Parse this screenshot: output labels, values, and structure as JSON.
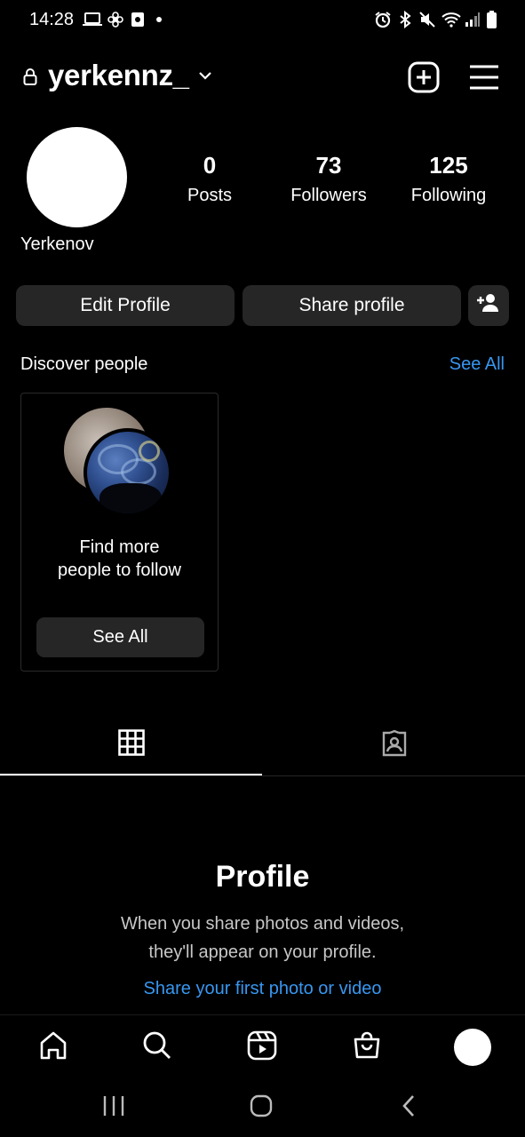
{
  "status_bar": {
    "time": "14:28"
  },
  "header": {
    "username": "yerkennz_"
  },
  "profile": {
    "display_name": "Yerkenov",
    "stats": {
      "posts": {
        "value": "0",
        "label": "Posts"
      },
      "followers": {
        "value": "73",
        "label": "Followers"
      },
      "following": {
        "value": "125",
        "label": "Following"
      }
    }
  },
  "actions": {
    "edit_label": "Edit Profile",
    "share_label": "Share profile"
  },
  "discover": {
    "title": "Discover people",
    "see_all": "See All",
    "card": {
      "line1": "Find more",
      "line2": "people to follow",
      "button": "See All"
    }
  },
  "empty_state": {
    "title": "Profile",
    "line1": "When you share photos and videos,",
    "line2": "they'll appear on your profile.",
    "link": "Share your first photo or video"
  },
  "colors": {
    "background": "#000000",
    "button": "#262626",
    "link": "#3897f0",
    "text": "#ffffff",
    "secondary_text": "#c7c7c7"
  },
  "icons": {
    "status_bar_left": [
      "laptop-icon",
      "fan-icon",
      "screen-record-icon",
      "dot-icon"
    ],
    "status_bar_right": [
      "alarm-icon",
      "bluetooth-icon",
      "mute-icon",
      "wifi-icon",
      "signal-icon",
      "battery-icon"
    ],
    "bottom_nav": [
      "home-icon",
      "search-icon",
      "reels-icon",
      "shop-icon",
      "profile-avatar"
    ],
    "system_nav": [
      "recents-icon",
      "home-system-icon",
      "back-icon"
    ]
  }
}
